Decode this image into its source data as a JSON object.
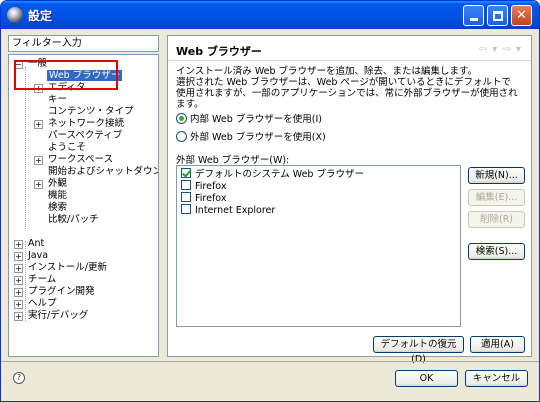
{
  "window": {
    "title": "設定",
    "icon": "gear-icon"
  },
  "filter": {
    "placeholder": "フィルター入力"
  },
  "tree": {
    "items": [
      {
        "label": "一般",
        "expander": "−"
      },
      {
        "label": "Web ブラウザー"
      },
      {
        "label": "エディタ",
        "expander": "+"
      },
      {
        "label": "キー"
      },
      {
        "label": "コンテンツ・タイプ"
      },
      {
        "label": "ネットワーク接続",
        "expander": "+"
      },
      {
        "label": "パースペクティブ"
      },
      {
        "label": "ようこそ"
      },
      {
        "label": "ワークスペース",
        "expander": "+"
      },
      {
        "label": "開始およびシャットダウン"
      },
      {
        "label": "外観",
        "expander": "+"
      },
      {
        "label": "機能"
      },
      {
        "label": "検索"
      },
      {
        "label": "比較/パッチ"
      },
      {
        "label": "Ant",
        "expander": "+"
      },
      {
        "label": "Java",
        "expander": "+"
      },
      {
        "label": "インストール/更新",
        "expander": "+"
      },
      {
        "label": "チーム",
        "expander": "+"
      },
      {
        "label": "プラグイン開発",
        "expander": "+"
      },
      {
        "label": "ヘルプ",
        "expander": "+"
      },
      {
        "label": "実行/デバッグ",
        "expander": "+"
      }
    ]
  },
  "page": {
    "title": "Web ブラウザー",
    "nav": "⇦ ▾ ⇨ ▾",
    "description": [
      "インストール済み Web ブラウザーを追加、除去、または編集します。",
      "選択された Web ブラウザーは、Web ページが開いているときにデフォルトで",
      "使用されますが、一部のアプリケーションでは、常に外部ブラウザーが使用されます。"
    ],
    "radio_internal": "内部 Web ブラウザーを使用(I)",
    "radio_external": "外部 Web ブラウザーを使用(X)",
    "radio_selected": "internal",
    "external_label": "外部 Web ブラウザー(W):",
    "browsers": [
      {
        "label": "デフォルトのシステム Web ブラウザー",
        "checked": true
      },
      {
        "label": "Firefox",
        "checked": false
      },
      {
        "label": "Firefox",
        "checked": false
      },
      {
        "label": "Internet Explorer",
        "checked": false
      }
    ],
    "buttons": {
      "new": "新規(N)...",
      "edit": "編集(E)...",
      "delete": "削除(R)",
      "search": "検索(S)...",
      "restore_defaults": "デフォルトの復元(D)",
      "apply": "適用(A)"
    }
  },
  "footer": {
    "ok": "OK",
    "cancel": "キャンセル"
  },
  "colors": {
    "titlebar": "#0055ea",
    "selection": "#316ac5",
    "annotation_box": "#e00000"
  }
}
